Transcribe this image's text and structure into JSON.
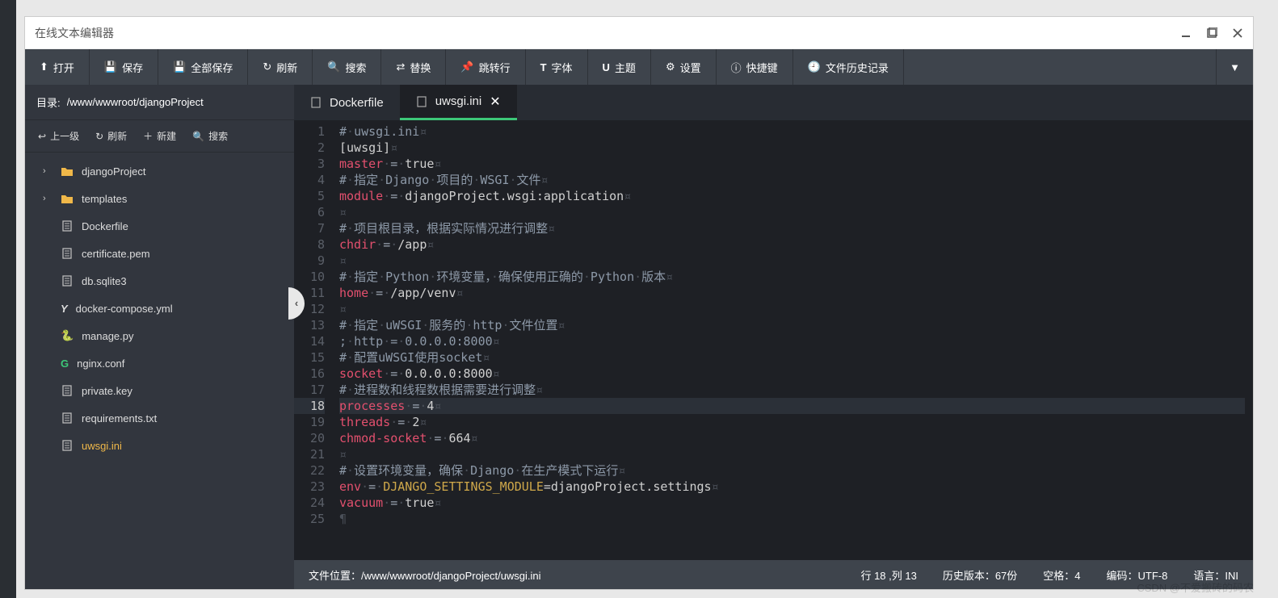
{
  "window": {
    "title": "在线文本编辑器"
  },
  "toolbar": {
    "open": "打开",
    "save": "保存",
    "saveAll": "全部保存",
    "refresh": "刷新",
    "search": "搜索",
    "replace": "替换",
    "goto": "跳转行",
    "font": "字体",
    "theme": "主题",
    "settings": "设置",
    "shortcuts": "快捷键",
    "history": "文件历史记录"
  },
  "sidebar": {
    "dirLabel": "目录:",
    "dirPath": "/www/wwwroot/djangoProject",
    "up": "上一级",
    "refresh": "刷新",
    "new": "新建",
    "search": "搜索",
    "tree": [
      {
        "name": "djangoProject",
        "type": "folder",
        "expandable": true
      },
      {
        "name": "templates",
        "type": "folder",
        "expandable": true
      },
      {
        "name": "Dockerfile",
        "type": "file",
        "icon": "file"
      },
      {
        "name": "certificate.pem",
        "type": "file",
        "icon": "file"
      },
      {
        "name": "db.sqlite3",
        "type": "file",
        "icon": "file"
      },
      {
        "name": "docker-compose.yml",
        "type": "file",
        "icon": "Y"
      },
      {
        "name": "manage.py",
        "type": "file",
        "icon": "python"
      },
      {
        "name": "nginx.conf",
        "type": "file",
        "icon": "nginx"
      },
      {
        "name": "private.key",
        "type": "file",
        "icon": "file"
      },
      {
        "name": "requirements.txt",
        "type": "file",
        "icon": "file"
      },
      {
        "name": "uwsgi.ini",
        "type": "file",
        "icon": "file",
        "active": true
      }
    ]
  },
  "tabs": [
    {
      "name": "Dockerfile",
      "active": false
    },
    {
      "name": "uwsgi.ini",
      "active": true,
      "closable": true
    }
  ],
  "code": {
    "activeLine": 18,
    "lines": [
      [
        [
          "comm",
          "#"
        ],
        [
          "invis",
          "·"
        ],
        [
          "comm",
          "uwsgi.ini"
        ],
        [
          "invis",
          "¤"
        ]
      ],
      [
        [
          "sec",
          "[uwsgi]"
        ],
        [
          "invis",
          "¤"
        ]
      ],
      [
        [
          "key",
          "master"
        ],
        [
          "invis",
          "·"
        ],
        [
          "punc",
          "="
        ],
        [
          "invis",
          "·"
        ],
        [
          "str",
          "true"
        ],
        [
          "invis",
          "¤"
        ]
      ],
      [
        [
          "comm",
          "#"
        ],
        [
          "invis",
          "·"
        ],
        [
          "comm",
          "指定"
        ],
        [
          "invis",
          "·"
        ],
        [
          "comm",
          "Django"
        ],
        [
          "invis",
          "·"
        ],
        [
          "comm",
          "项目的"
        ],
        [
          "invis",
          "·"
        ],
        [
          "comm",
          "WSGI"
        ],
        [
          "invis",
          "·"
        ],
        [
          "comm",
          "文件"
        ],
        [
          "invis",
          "¤"
        ]
      ],
      [
        [
          "key",
          "module"
        ],
        [
          "invis",
          "·"
        ],
        [
          "punc",
          "="
        ],
        [
          "invis",
          "·"
        ],
        [
          "str",
          "djangoProject.wsgi:application"
        ],
        [
          "invis",
          "¤"
        ]
      ],
      [
        [
          "invis",
          "¤"
        ]
      ],
      [
        [
          "comm",
          "#"
        ],
        [
          "invis",
          "·"
        ],
        [
          "comm",
          "项目根目录，根据实际情况进行调整"
        ],
        [
          "invis",
          "¤"
        ]
      ],
      [
        [
          "key",
          "chdir"
        ],
        [
          "invis",
          "·"
        ],
        [
          "punc",
          "="
        ],
        [
          "invis",
          "·"
        ],
        [
          "str",
          "/app"
        ],
        [
          "invis",
          "¤"
        ]
      ],
      [
        [
          "invis",
          "¤"
        ]
      ],
      [
        [
          "comm",
          "#"
        ],
        [
          "invis",
          "·"
        ],
        [
          "comm",
          "指定"
        ],
        [
          "invis",
          "·"
        ],
        [
          "comm",
          "Python"
        ],
        [
          "invis",
          "·"
        ],
        [
          "comm",
          "环境变量，"
        ],
        [
          "invis",
          "·"
        ],
        [
          "comm",
          "确保使用正确的"
        ],
        [
          "invis",
          "·"
        ],
        [
          "comm",
          "Python"
        ],
        [
          "invis",
          "·"
        ],
        [
          "comm",
          "版本"
        ],
        [
          "invis",
          "¤"
        ]
      ],
      [
        [
          "key",
          "home"
        ],
        [
          "invis",
          "·"
        ],
        [
          "punc",
          "="
        ],
        [
          "invis",
          "·"
        ],
        [
          "str",
          "/app/venv"
        ],
        [
          "invis",
          "¤"
        ]
      ],
      [
        [
          "invis",
          "¤"
        ]
      ],
      [
        [
          "comm",
          "#"
        ],
        [
          "invis",
          "·"
        ],
        [
          "comm",
          "指定"
        ],
        [
          "invis",
          "·"
        ],
        [
          "comm",
          "uWSGI"
        ],
        [
          "invis",
          "·"
        ],
        [
          "comm",
          "服务的"
        ],
        [
          "invis",
          "·"
        ],
        [
          "comm",
          "http"
        ],
        [
          "invis",
          "·"
        ],
        [
          "comm",
          "文件位置"
        ],
        [
          "invis",
          "¤"
        ]
      ],
      [
        [
          "comm",
          ";"
        ],
        [
          "invis",
          "·"
        ],
        [
          "comm",
          "http"
        ],
        [
          "invis",
          "·"
        ],
        [
          "comm",
          "="
        ],
        [
          "invis",
          "·"
        ],
        [
          "comm",
          "0.0.0.0:8000"
        ],
        [
          "invis",
          "¤"
        ]
      ],
      [
        [
          "comm",
          "#"
        ],
        [
          "invis",
          "·"
        ],
        [
          "comm",
          "配置uWSGI使用socket"
        ],
        [
          "invis",
          "¤"
        ]
      ],
      [
        [
          "key",
          "socket"
        ],
        [
          "invis",
          "·"
        ],
        [
          "punc",
          "="
        ],
        [
          "invis",
          "·"
        ],
        [
          "str",
          "0.0.0.0:8000"
        ],
        [
          "invis",
          "¤"
        ]
      ],
      [
        [
          "comm",
          "#"
        ],
        [
          "invis",
          "·"
        ],
        [
          "comm",
          "进程数和线程数根据需要进行调整"
        ],
        [
          "invis",
          "¤"
        ]
      ],
      [
        [
          "key",
          "processes"
        ],
        [
          "invis",
          "·"
        ],
        [
          "punc",
          "="
        ],
        [
          "invis",
          "·"
        ],
        [
          "str",
          "4"
        ],
        [
          "invis",
          "¤"
        ]
      ],
      [
        [
          "key",
          "threads"
        ],
        [
          "invis",
          "·"
        ],
        [
          "punc",
          "="
        ],
        [
          "invis",
          "·"
        ],
        [
          "str",
          "2"
        ],
        [
          "invis",
          "¤"
        ]
      ],
      [
        [
          "key",
          "chmod-socket"
        ],
        [
          "invis",
          "·"
        ],
        [
          "punc",
          "="
        ],
        [
          "invis",
          "·"
        ],
        [
          "str",
          "664"
        ],
        [
          "invis",
          "¤"
        ]
      ],
      [
        [
          "invis",
          "¤"
        ]
      ],
      [
        [
          "comm",
          "#"
        ],
        [
          "invis",
          "·"
        ],
        [
          "comm",
          "设置环境变量，确保"
        ],
        [
          "invis",
          "·"
        ],
        [
          "comm",
          "Django"
        ],
        [
          "invis",
          "·"
        ],
        [
          "comm",
          "在生产模式下运行"
        ],
        [
          "invis",
          "¤"
        ]
      ],
      [
        [
          "key",
          "env"
        ],
        [
          "invis",
          "·"
        ],
        [
          "punc",
          "="
        ],
        [
          "invis",
          "·"
        ],
        [
          "id",
          "DJANGO_SETTINGS_MODULE"
        ],
        [
          "str",
          "=djangoProject.settings"
        ],
        [
          "invis",
          "¤"
        ]
      ],
      [
        [
          "key",
          "vacuum"
        ],
        [
          "invis",
          "·"
        ],
        [
          "punc",
          "="
        ],
        [
          "invis",
          "·"
        ],
        [
          "str",
          "true"
        ],
        [
          "invis",
          "¤"
        ]
      ],
      [
        [
          "invis",
          "¶"
        ]
      ]
    ]
  },
  "status": {
    "pathLabel": "文件位置：",
    "path": "/www/wwwroot/djangoProject/uwsgi.ini",
    "pos": "行 18 ,列 13",
    "history": "历史版本：67份",
    "indent": "空格：4",
    "encoding": "编码：UTF-8",
    "lang": "语言：INI"
  },
  "watermark": "CSDN @不爱搬砖的码农"
}
